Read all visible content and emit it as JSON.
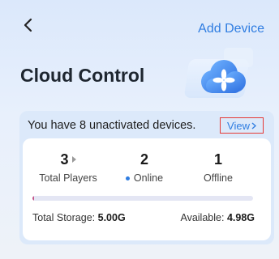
{
  "header": {
    "back_icon": "chevron-left-icon",
    "add_device_label": "Add Device"
  },
  "title": "Cloud Control",
  "banner": {
    "message": "You have 8 unactivated devices.",
    "view_label": "View",
    "view_icon": "chevron-right-icon"
  },
  "stats": [
    {
      "value": "3",
      "label": "Total Players"
    },
    {
      "value": "2",
      "label": "Online"
    },
    {
      "value": "1",
      "label": "Offline"
    }
  ],
  "storage": {
    "total_label": "Total Storage:",
    "total_value": "5.00G",
    "available_label": "Available:",
    "available_value": "4.98G",
    "used_fraction": 0.004
  },
  "colors": {
    "accent": "#2f7de1",
    "highlight_border": "#e53935",
    "usage_bar": "#c2568a"
  }
}
